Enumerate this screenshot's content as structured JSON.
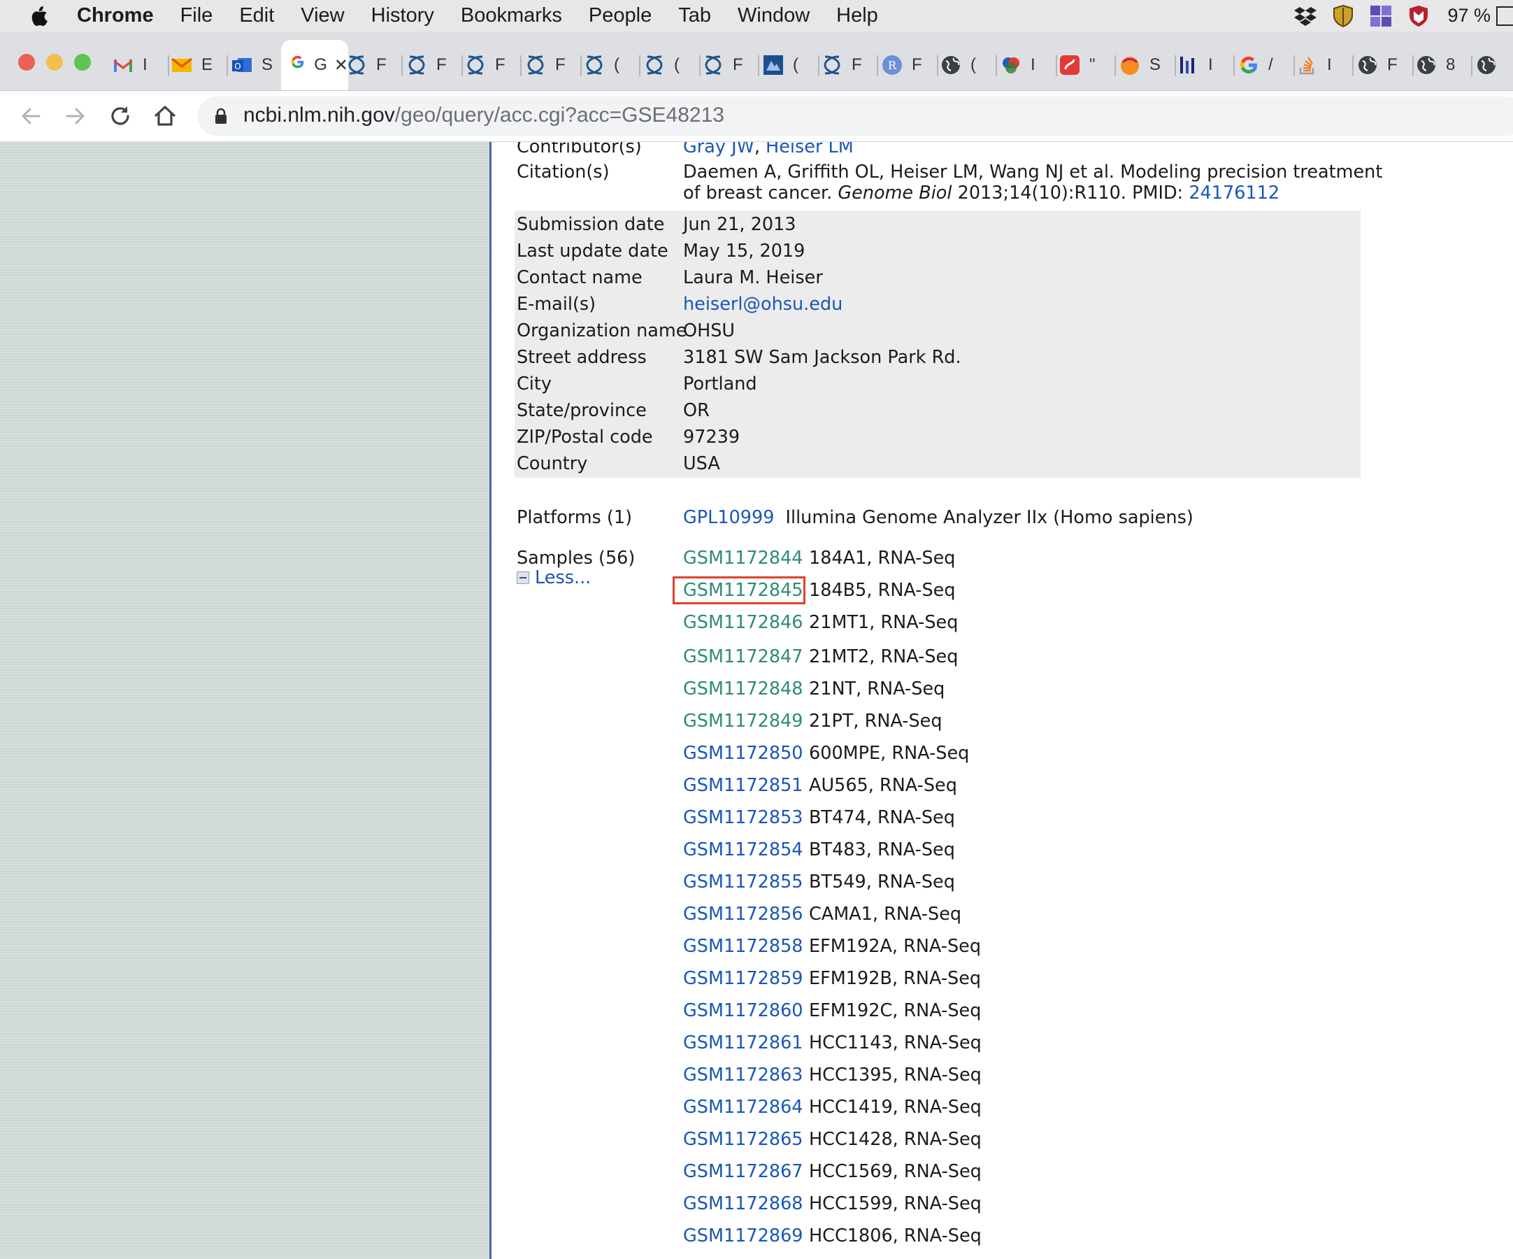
{
  "menubar": {
    "app_name": "Chrome",
    "items": [
      "File",
      "Edit",
      "View",
      "History",
      "Bookmarks",
      "People",
      "Tab",
      "Window",
      "Help"
    ],
    "battery": "97 %"
  },
  "tabs": [
    {
      "icon": "gmail-icon",
      "text": "I"
    },
    {
      "icon": "mail-icon",
      "text": "E"
    },
    {
      "icon": "outlook-icon",
      "text": "S"
    },
    {
      "icon": "google-icon",
      "text": "G",
      "active": true
    },
    {
      "icon": "ncbi-helix-icon",
      "text": "F"
    },
    {
      "icon": "ncbi-helix-icon",
      "text": "F"
    },
    {
      "icon": "ncbi-helix-icon",
      "text": "F"
    },
    {
      "icon": "ncbi-helix-icon",
      "text": "F"
    },
    {
      "icon": "ncbi-helix-icon",
      "text": "("
    },
    {
      "icon": "ncbi-helix-icon",
      "text": "("
    },
    {
      "icon": "ncbi-helix-icon",
      "text": "F"
    },
    {
      "icon": "nea-icon",
      "text": "("
    },
    {
      "icon": "ncbi-helix-icon",
      "text": "F"
    },
    {
      "icon": "r-icon",
      "text": "F"
    },
    {
      "icon": "globe-icon",
      "text": "("
    },
    {
      "icon": "colorful-icon",
      "text": "I"
    },
    {
      "icon": "red-app-icon",
      "text": "\""
    },
    {
      "icon": "orange-blob-icon",
      "text": "S"
    },
    {
      "icon": "bars-icon",
      "text": "I"
    },
    {
      "icon": "google-icon",
      "text": "/"
    },
    {
      "icon": "stackoverflow-icon",
      "text": "I"
    },
    {
      "icon": "globe-icon",
      "text": "F"
    },
    {
      "icon": "globe-icon",
      "text": "8"
    },
    {
      "icon": "globe-icon",
      "text": ""
    }
  ],
  "address": {
    "host": "ncbi.nlm.nih.gov",
    "path": "/geo/query/acc.cgi?acc=GSE48213"
  },
  "record": {
    "contributors_label": "Contributor(s)",
    "contributor_1": "Gray JW",
    "contributor_sep": ", ",
    "contributor_2": "Heiser LM",
    "citation_label": "Citation(s)",
    "citation_line1": "Daemen A, Griffith OL, Heiser LM, Wang NJ et al. Modeling precision treatment",
    "citation_line2_pre": "of breast cancer. ",
    "citation_journal": "Genome Biol",
    "citation_line2_post": " 2013;14(10):R110. PMID: ",
    "citation_pmid": "24176112",
    "info": [
      {
        "label": "Submission date",
        "value": "Jun 21, 2013"
      },
      {
        "label": "Last update date",
        "value": "May 15, 2019"
      },
      {
        "label": "Contact name",
        "value": "Laura M. Heiser"
      },
      {
        "label": "E-mail(s)",
        "value": "heiserl@ohsu.edu",
        "link": true
      },
      {
        "label": "Organization name",
        "value": "OHSU"
      },
      {
        "label": "Street address",
        "value": "3181 SW Sam Jackson Park Rd."
      },
      {
        "label": "City",
        "value": "Portland"
      },
      {
        "label": "State/province",
        "value": "OR"
      },
      {
        "label": "ZIP/Postal code",
        "value": "97239"
      },
      {
        "label": "Country",
        "value": "USA"
      }
    ],
    "platforms_label": "Platforms (1)",
    "platform_acc": "GPL10999",
    "platform_desc": "Illumina Genome Analyzer IIx (Homo sapiens)",
    "samples_label": "Samples (56)",
    "less_label": "Less...",
    "samples": [
      {
        "acc": "GSM1172844",
        "desc": "184A1, RNA-Seq",
        "visited": true
      },
      {
        "acc": "GSM1172845",
        "desc": "184B5, RNA-Seq",
        "visited": true
      },
      {
        "acc": "GSM1172846",
        "desc": "21MT1, RNA-Seq",
        "visited": true
      },
      {
        "acc": "GSM1172847",
        "desc": "21MT2, RNA-Seq",
        "visited": true
      },
      {
        "acc": "GSM1172848",
        "desc": "21NT, RNA-Seq",
        "visited": true
      },
      {
        "acc": "GSM1172849",
        "desc": "21PT, RNA-Seq",
        "visited": true
      },
      {
        "acc": "GSM1172850",
        "desc": "600MPE, RNA-Seq"
      },
      {
        "acc": "GSM1172851",
        "desc": "AU565, RNA-Seq"
      },
      {
        "acc": "GSM1172853",
        "desc": "BT474, RNA-Seq"
      },
      {
        "acc": "GSM1172854",
        "desc": "BT483, RNA-Seq"
      },
      {
        "acc": "GSM1172855",
        "desc": "BT549, RNA-Seq"
      },
      {
        "acc": "GSM1172856",
        "desc": "CAMA1, RNA-Seq"
      },
      {
        "acc": "GSM1172858",
        "desc": "EFM192A, RNA-Seq"
      },
      {
        "acc": "GSM1172859",
        "desc": "EFM192B, RNA-Seq"
      },
      {
        "acc": "GSM1172860",
        "desc": "EFM192C, RNA-Seq"
      },
      {
        "acc": "GSM1172861",
        "desc": "HCC1143, RNA-Seq"
      },
      {
        "acc": "GSM1172863",
        "desc": "HCC1395, RNA-Seq"
      },
      {
        "acc": "GSM1172864",
        "desc": "HCC1419, RNA-Seq"
      },
      {
        "acc": "GSM1172865",
        "desc": "HCC1428, RNA-Seq"
      },
      {
        "acc": "GSM1172867",
        "desc": "HCC1569, RNA-Seq"
      },
      {
        "acc": "GSM1172868",
        "desc": "HCC1599, RNA-Seq"
      },
      {
        "acc": "GSM1172869",
        "desc": "HCC1806, RNA-Seq"
      }
    ]
  },
  "colors": {
    "link": "#1a56b8",
    "visited_link": "#2f8a7a",
    "highlight": "#e0402c"
  }
}
